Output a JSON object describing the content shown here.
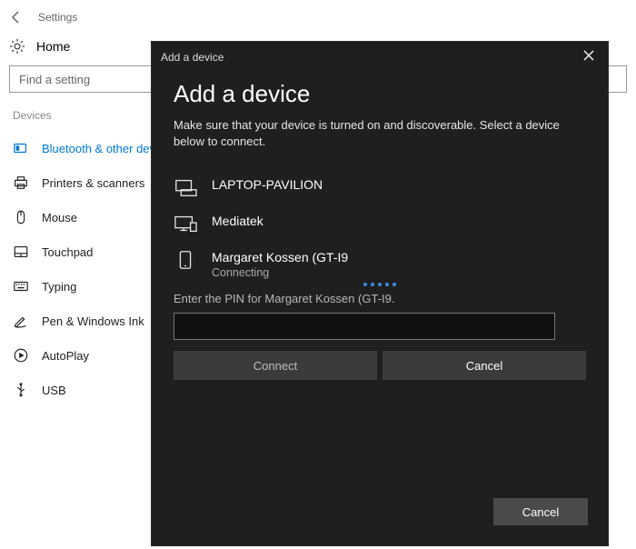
{
  "topbar": {
    "title": "Settings"
  },
  "home": {
    "label": "Home"
  },
  "search": {
    "placeholder": "Find a setting"
  },
  "sidebar": {
    "section_label": "Devices",
    "items": [
      {
        "label": "Bluetooth & other dev",
        "icon": "bluetooth-icon",
        "active": true
      },
      {
        "label": "Printers & scanners",
        "icon": "printer-icon"
      },
      {
        "label": "Mouse",
        "icon": "mouse-icon"
      },
      {
        "label": "Touchpad",
        "icon": "touchpad-icon"
      },
      {
        "label": "Typing",
        "icon": "keyboard-icon"
      },
      {
        "label": "Pen & Windows Ink",
        "icon": "pen-icon"
      },
      {
        "label": "AutoPlay",
        "icon": "autoplay-icon"
      },
      {
        "label": "USB",
        "icon": "usb-icon"
      }
    ]
  },
  "dialog": {
    "titlebar": "Add a device",
    "heading": "Add a device",
    "subtext": "Make sure that your device is turned on and discoverable. Select a device below to connect.",
    "devices": [
      {
        "name": "LAPTOP-PAVILION",
        "icon": "laptop-icon"
      },
      {
        "name": "Mediatek",
        "icon": "display-icon"
      },
      {
        "name": "Margaret Kossen (GT-I9",
        "icon": "phone-icon",
        "status": "Connecting"
      }
    ],
    "pin_prompt": "Enter the PIN for Margaret Kossen (GT-I9.",
    "pin_value": "",
    "connect_label": "Connect",
    "cancel_label": "Cancel",
    "bottom_cancel": "Cancel"
  }
}
